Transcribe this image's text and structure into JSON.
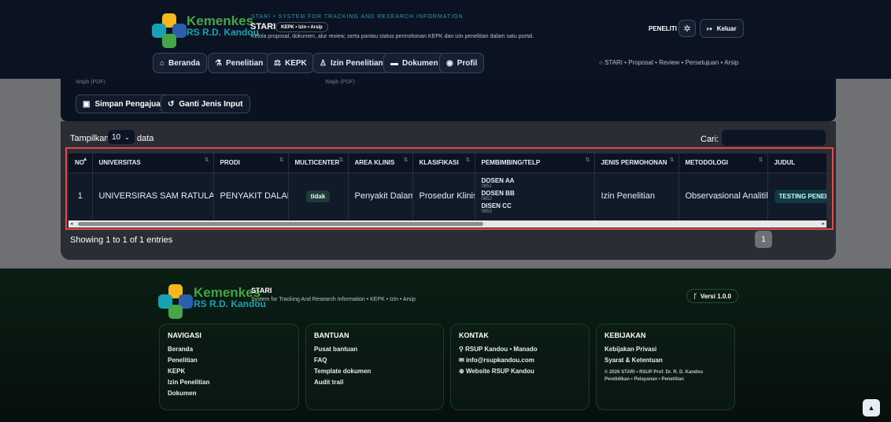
{
  "header": {
    "brand_main": "Kemenkes",
    "brand_sub": "RS R.D. Kandou",
    "app_name": "STARI",
    "tagline": "STARI • SYSTEM FOR TRACKING AND RESEARCH INFORMATION",
    "chip": "KEPK • Izin • Arsip",
    "description": "Kelola proposal, dokumen, alur review, serta pantau status permohonan KEPK dan izin penelitian dalam satu portal.",
    "role": "PENELITI",
    "logout_label": "Keluar",
    "nav": [
      {
        "label": "Beranda",
        "icon": "home-icon"
      },
      {
        "label": "Penelitian",
        "icon": "flask-icon"
      },
      {
        "label": "KEPK",
        "icon": "scale-icon"
      },
      {
        "label": "Izin Penelitian",
        "icon": "stamp-icon"
      },
      {
        "label": "Dokumen",
        "icon": "folder-icon"
      },
      {
        "label": "Profil",
        "icon": "user-icon"
      }
    ],
    "flow": "STARI • Proposal • Review • Persetujuan • Arsip"
  },
  "form": {
    "label_left": "Wajib (PDF)",
    "label_right": "Wajib (PDF)",
    "save_label": "Simpan Pengajuan",
    "switch_label": "Ganti Jenis Input"
  },
  "table_controls": {
    "show_prefix": "Tampilkan",
    "page_size": "10",
    "show_suffix": "data",
    "search_label": "Cari:"
  },
  "table": {
    "columns": [
      "NO",
      "UNIVERSITAS",
      "PRODI",
      "MULTICENTER",
      "AREA KLINIS",
      "KLASIFIKASI",
      "PEMBIMBING/TELP",
      "JENIS PERMOHONAN",
      "METODOLOGI",
      "JUDUL"
    ],
    "rows": [
      {
        "no": "1",
        "universitas": "UNIVERSIRAS SAM RATULANGI",
        "prodi": "PENYAKIT DALAM",
        "multicenter": "tidak",
        "area_klinis": "Penyakit Dalam",
        "klasifikasi": "Prosedur Klinis",
        "pembimbing": [
          {
            "name": "DOSEN AA",
            "phone": "0851"
          },
          {
            "name": "DOSEN BB",
            "phone": "0852"
          },
          {
            "name": "DISEN CC",
            "phone": "0853"
          }
        ],
        "jenis_permohonan": "Izin Penelitian",
        "metodologi": "Observasional Analitik",
        "judul": "TESTING PENELITI"
      }
    ],
    "info": "Showing 1 to 1 of 1 entries",
    "current_page": "1"
  },
  "footer": {
    "brand_main": "Kemenkes",
    "brand_sub": "RS R.D. Kandou",
    "app_name": "STARI",
    "subtitle": "System for Tracking And Research Information • KEPK • Izin • Arsip",
    "version": "Versi 1.0.0",
    "navigasi": {
      "title": "NAVIGASI",
      "links": [
        "Beranda",
        "Penelitian",
        "KEPK",
        "Izin Penelitian",
        "Dokumen"
      ]
    },
    "bantuan": {
      "title": "BANTUAN",
      "links": [
        "Pusat bantuan",
        "FAQ",
        "Template dokumen",
        "Audit trail"
      ]
    },
    "kontak": {
      "title": "KONTAK",
      "location": "RSUP Kandou • Manado",
      "email": "info@rsupkandou.com",
      "website": "Website RSUP Kandou"
    },
    "kebijakan": {
      "title": "KEBIJAKAN",
      "links": [
        "Kebijakan Privasi",
        "Syarat & Ketentuan"
      ],
      "copyright": "© 2026 STARI • RSUP Prof. Dr. R. D. Kandou",
      "motto": "Pendidikan • Pelayanan • Penelitian"
    }
  },
  "colors": {
    "accent_green": "#44a648",
    "accent_teal": "#16a2b4",
    "highlight_red": "#e04a4a"
  }
}
